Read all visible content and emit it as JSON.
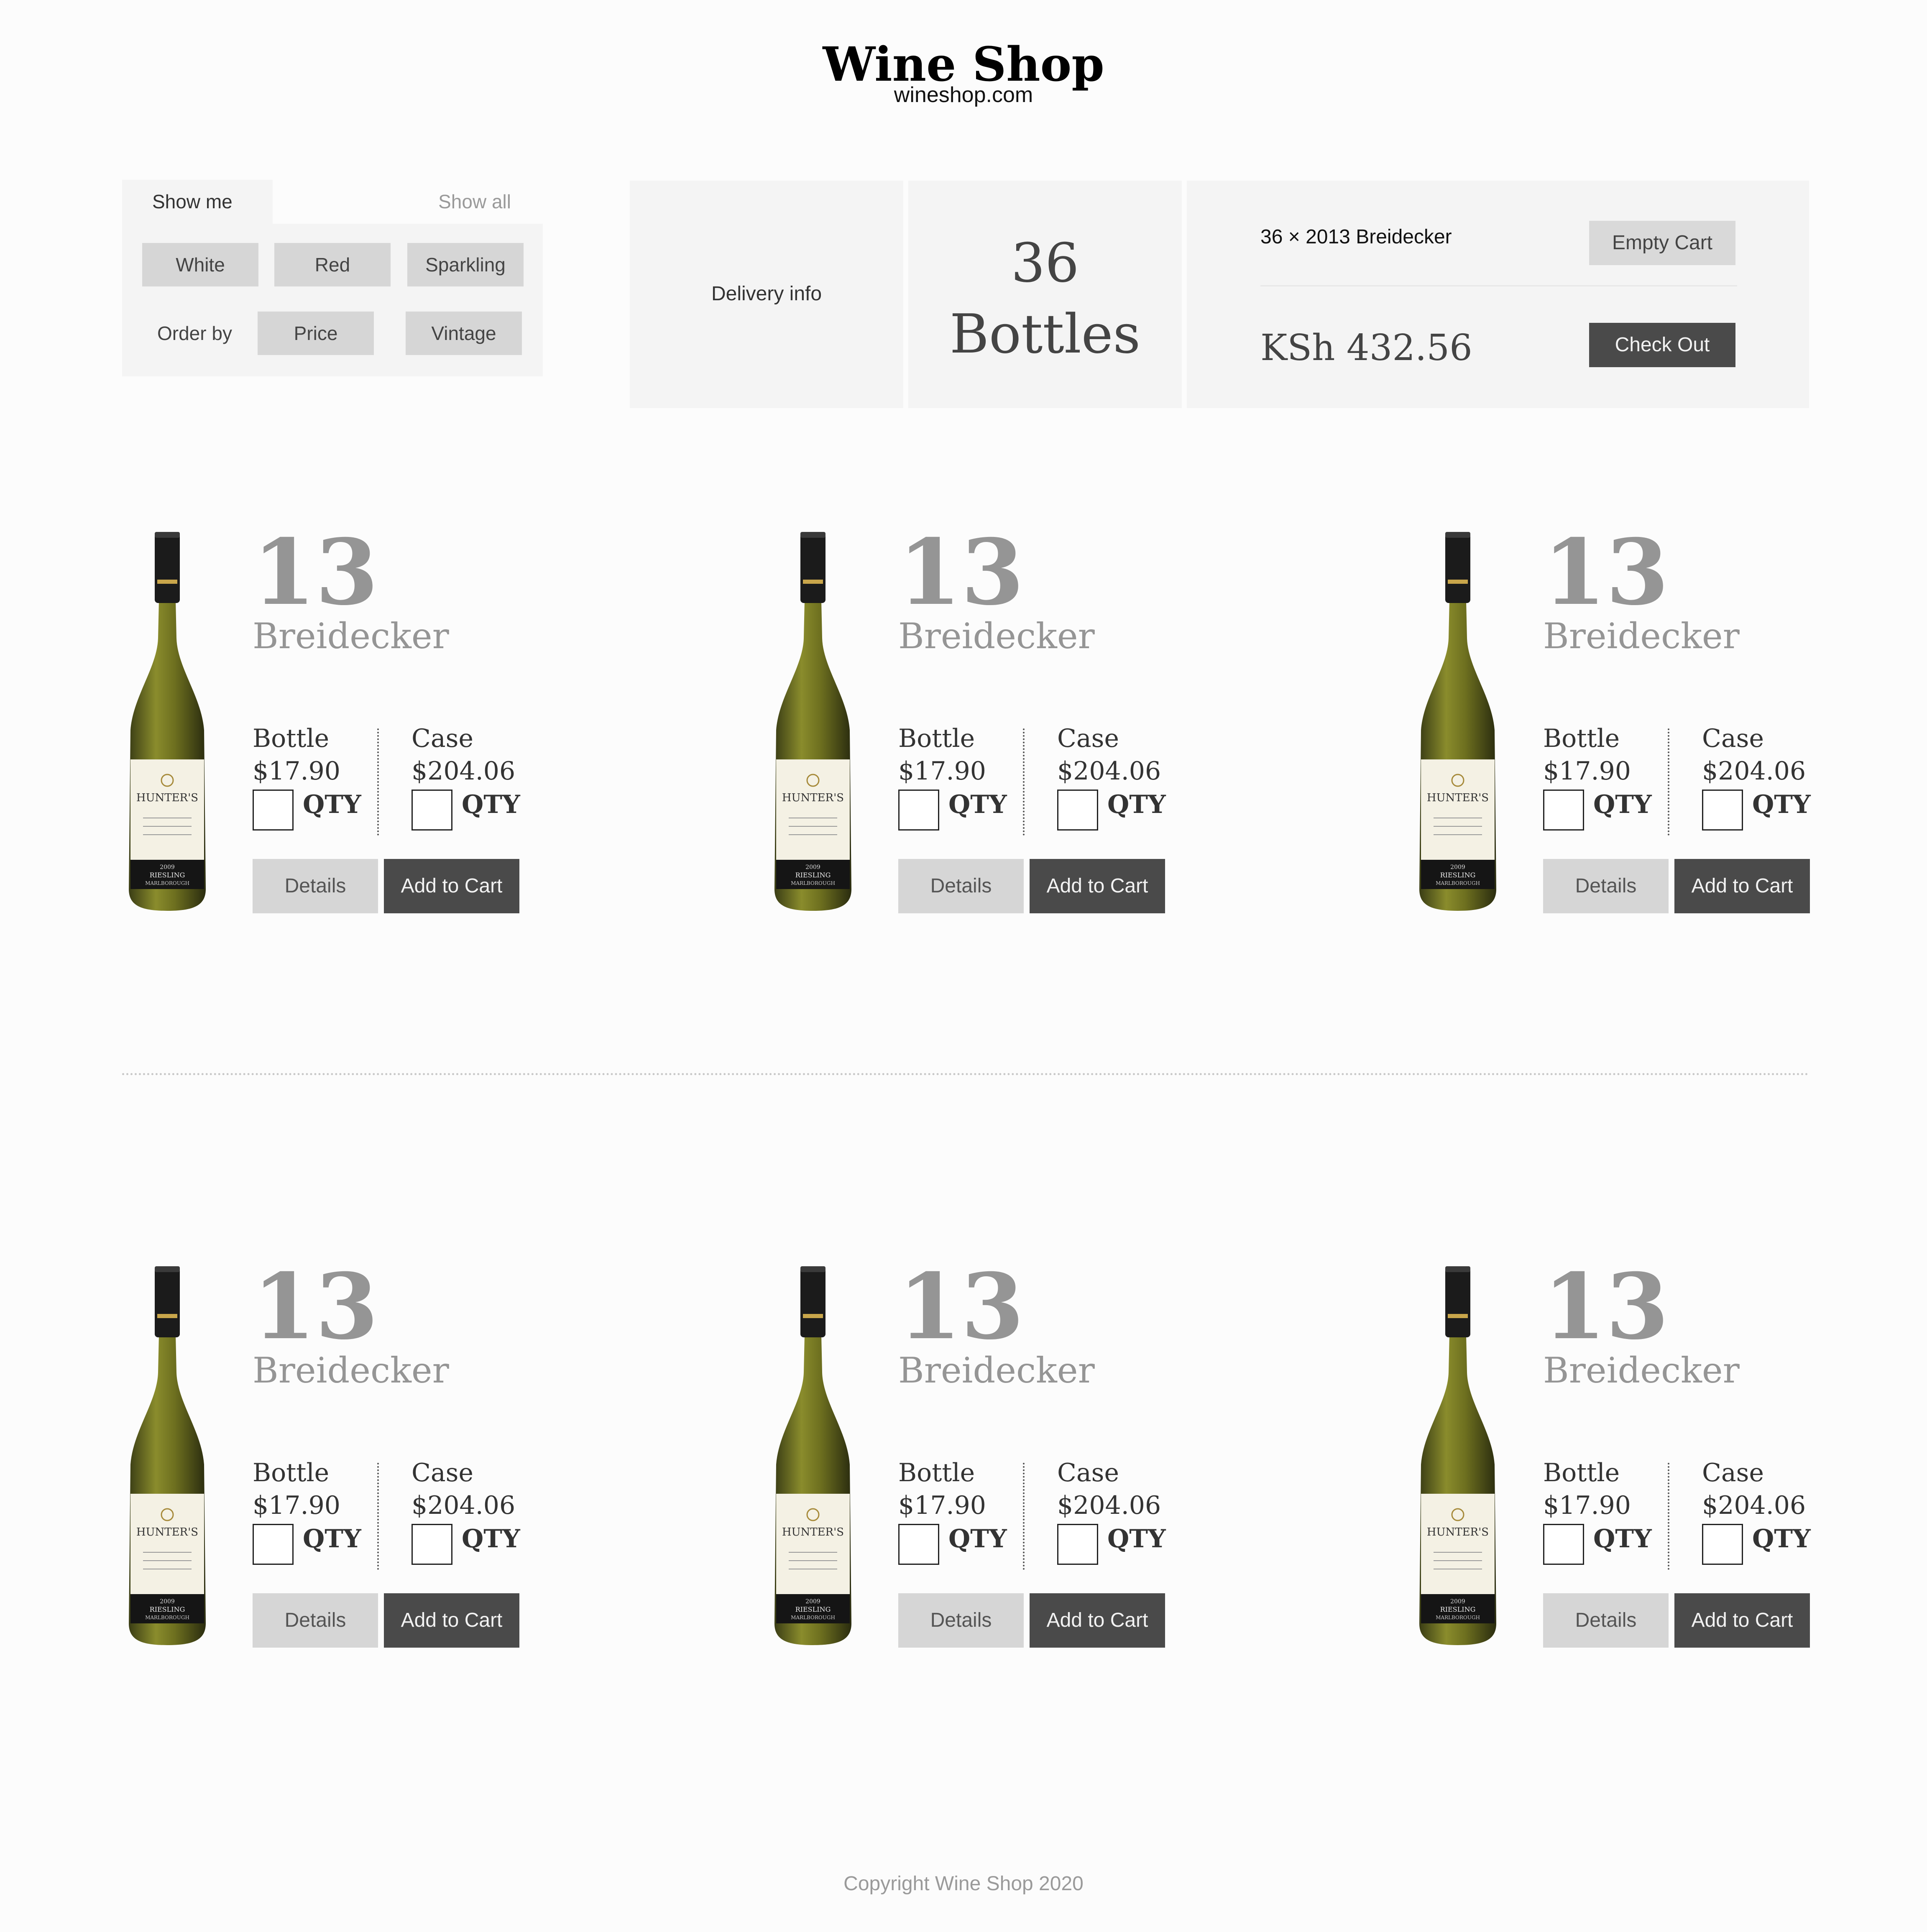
{
  "header": {
    "title": "Wine Shop",
    "domain": "wineshop.com"
  },
  "filters": {
    "tab_active": "Show me",
    "tab_inactive": "Show all",
    "types": [
      "White",
      "Red",
      "Sparkling"
    ],
    "order_label": "Order by",
    "order_options": [
      "Price",
      "Vintage"
    ]
  },
  "delivery": {
    "label": "Delivery info"
  },
  "cart": {
    "bottle_count": "36",
    "bottle_word": "Bottles",
    "summary": "36 × 2013 Breidecker",
    "total": "KSh 432.56",
    "empty_label": "Empty Cart",
    "checkout_label": "Check Out"
  },
  "bottle_label": {
    "brand": "HUNTER'S",
    "year": "2009",
    "variety": "RIESLING",
    "region": "MARLBOROUGH"
  },
  "products": [
    {
      "year": "13",
      "name": "Breidecker",
      "bottle_label": "Bottle",
      "bottle_price": "$17.90",
      "case_label": "Case",
      "case_price": "$204.06",
      "qty_label": "QTY",
      "details_label": "Details",
      "add_label": "Add to Cart"
    },
    {
      "year": "13",
      "name": "Breidecker",
      "bottle_label": "Bottle",
      "bottle_price": "$17.90",
      "case_label": "Case",
      "case_price": "$204.06",
      "qty_label": "QTY",
      "details_label": "Details",
      "add_label": "Add to Cart"
    },
    {
      "year": "13",
      "name": "Breidecker",
      "bottle_label": "Bottle",
      "bottle_price": "$17.90",
      "case_label": "Case",
      "case_price": "$204.06",
      "qty_label": "QTY",
      "details_label": "Details",
      "add_label": "Add to Cart"
    },
    {
      "year": "13",
      "name": "Breidecker",
      "bottle_label": "Bottle",
      "bottle_price": "$17.90",
      "case_label": "Case",
      "case_price": "$204.06",
      "qty_label": "QTY",
      "details_label": "Details",
      "add_label": "Add to Cart"
    },
    {
      "year": "13",
      "name": "Breidecker",
      "bottle_label": "Bottle",
      "bottle_price": "$17.90",
      "case_label": "Case",
      "case_price": "$204.06",
      "qty_label": "QTY",
      "details_label": "Details",
      "add_label": "Add to Cart"
    },
    {
      "year": "13",
      "name": "Breidecker",
      "bottle_label": "Bottle",
      "bottle_price": "$17.90",
      "case_label": "Case",
      "case_price": "$204.06",
      "qty_label": "QTY",
      "details_label": "Details",
      "add_label": "Add to Cart"
    }
  ],
  "footer": {
    "copyright": "Copyright Wine Shop 2020"
  }
}
